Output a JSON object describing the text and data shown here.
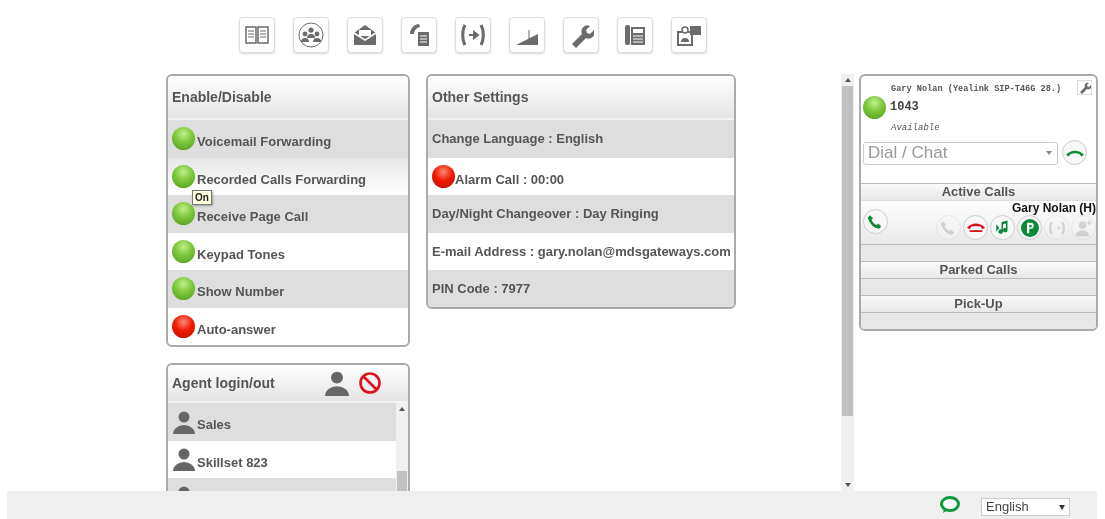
{
  "toolbar": [
    {
      "kind": "book"
    },
    {
      "kind": "people"
    },
    {
      "kind": "envelope"
    },
    {
      "kind": "phone-document"
    },
    {
      "kind": "transfer"
    },
    {
      "kind": "ramp"
    },
    {
      "kind": "wrench"
    },
    {
      "kind": "desk-phone"
    },
    {
      "kind": "presenter"
    }
  ],
  "enable_disable": {
    "title": "Enable/Disable",
    "tooltip": "On",
    "items": [
      {
        "label": "Voicemail Forwarding",
        "on": true
      },
      {
        "label": "Recorded Calls Forwarding",
        "on": true
      },
      {
        "label": "Receive Page Call",
        "on": true
      },
      {
        "label": "Keypad Tones",
        "on": true
      },
      {
        "label": "Show Number",
        "on": true
      },
      {
        "label": "Auto-answer",
        "on": false
      }
    ]
  },
  "agent_login": {
    "title": "Agent login/out",
    "groups": [
      {
        "name": "Sales"
      },
      {
        "name": "Skillset 823"
      }
    ]
  },
  "other_settings": {
    "title": "Other Settings",
    "items": [
      {
        "kind": "text",
        "label": "Change Language : English"
      },
      {
        "kind": "toggle",
        "label": "Alarm Call : 00:00",
        "on": false
      },
      {
        "kind": "text",
        "label": "Day/Night Changeover : Day Ringing"
      },
      {
        "kind": "text",
        "label": "E-mail Address : gary.nolan@mdsgateways.com"
      },
      {
        "kind": "text",
        "label": "PIN Code : 7977"
      }
    ]
  },
  "phone": {
    "name": "Gary Nolan (Yealink SIP-T46G 28.)",
    "extension": "1043",
    "status": "Available",
    "available": true,
    "dial_placeholder": "Dial / Chat",
    "active_calls_title": "Active Calls",
    "call": {
      "caller": "Gary Nolan (H)",
      "actions": [
        {
          "kind": "answer",
          "disabled": true
        },
        {
          "kind": "hangup",
          "disabled": false
        },
        {
          "kind": "music",
          "disabled": false
        },
        {
          "kind": "park",
          "disabled": false
        },
        {
          "kind": "transfer",
          "disabled": true
        },
        {
          "kind": "add-contact",
          "disabled": true
        }
      ]
    },
    "parked_calls_title": "Parked Calls",
    "pickup_title": "Pick-Up"
  },
  "footer": {
    "language": "English"
  }
}
